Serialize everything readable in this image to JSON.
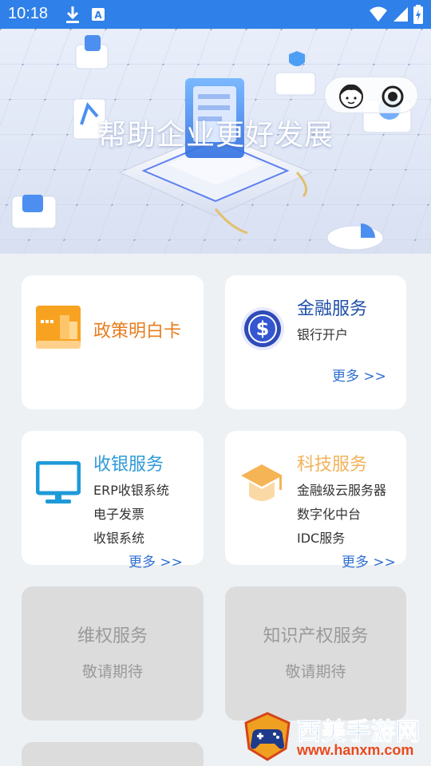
{
  "status_bar": {
    "time": "10:18",
    "left_icons": [
      "download-icon",
      "a-icon"
    ],
    "right_icons": [
      "wifi-icon",
      "signal-icon",
      "battery-icon"
    ],
    "color": "#2f80e8"
  },
  "banner": {
    "title": "帮助企业更好发展",
    "capsule_icons": [
      "avatar-icon",
      "record-icon"
    ]
  },
  "cards": [
    {
      "title": "政策明白卡",
      "title_color": "#e87d1e",
      "icon": "policy-card-icon"
    },
    {
      "title": "金融服务",
      "title_color": "#1f4fa8",
      "lines": [
        "银行开户"
      ],
      "more": "更多 >>",
      "icon": "dollar-coin-icon"
    },
    {
      "title": "收银服务",
      "title_color": "#2f9ad8",
      "lines": [
        "ERP收银系统",
        "电子发票",
        "收银系统"
      ],
      "more": "更多 >>",
      "icon": "monitor-icon"
    },
    {
      "title": "科技服务",
      "title_color": "#f0b35a",
      "lines": [
        "金融级云服务器",
        "数字化中台",
        "IDC服务"
      ],
      "more": "更多 >>",
      "icon": "graduation-cap-icon"
    },
    {
      "title": "维权服务",
      "sub": "敬请期待"
    },
    {
      "title": "知识产权服务",
      "sub": "敬请期待"
    }
  ],
  "watermark": {
    "text": "西美手游网",
    "url": "www.hanxm.com"
  }
}
